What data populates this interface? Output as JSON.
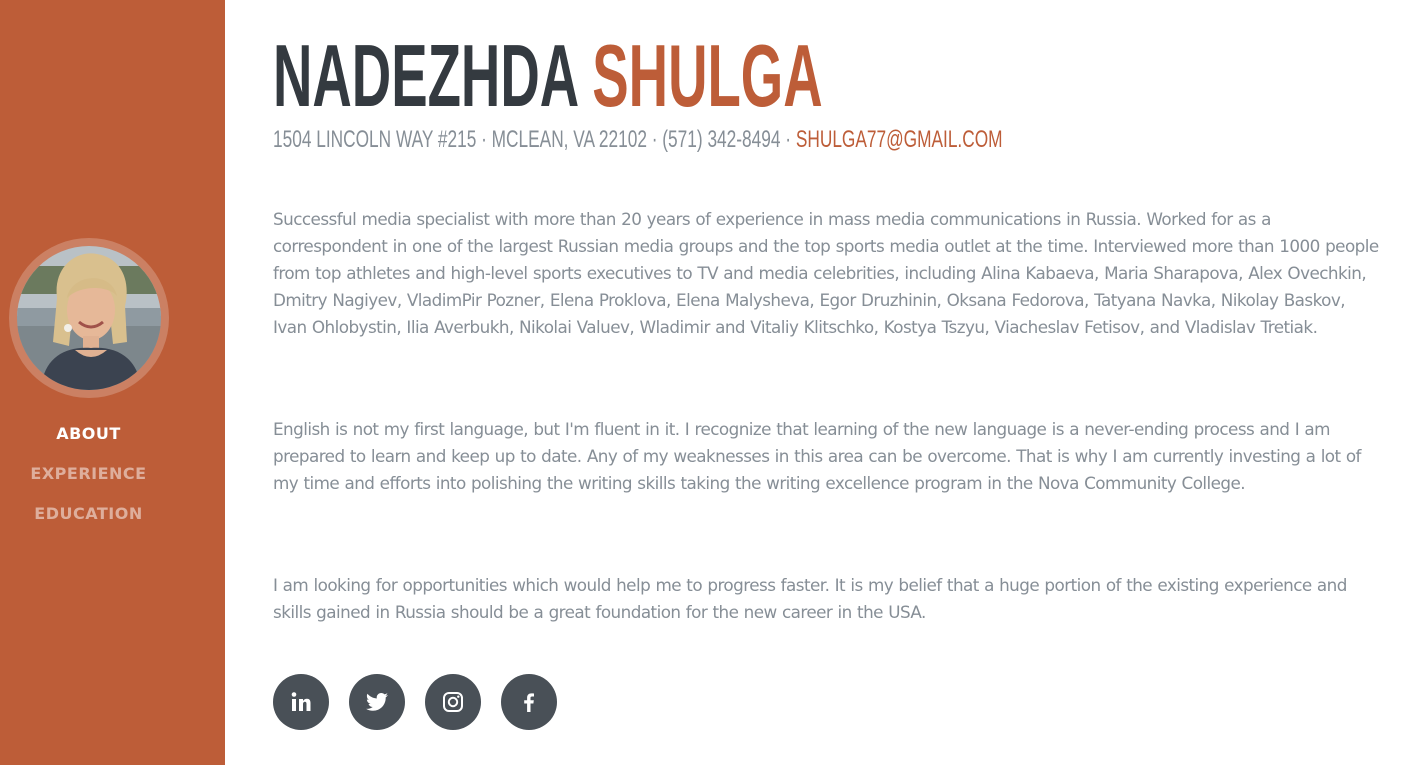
{
  "profile": {
    "first_name": "NADEZHDA",
    "last_name": "SHULGA",
    "address": "1504 LINCOLN WAY #215 · MCLEAN, VA 22102 · (571) 342-8494 ·",
    "email": "SHULGA77@GMAIL.COM"
  },
  "nav": {
    "items": [
      {
        "label": "ABOUT",
        "active": true
      },
      {
        "label": "EXPERIENCE",
        "active": false
      },
      {
        "label": "EDUCATION",
        "active": false
      }
    ]
  },
  "about": {
    "paragraphs": [
      "Successful media specialist with more than 20 years of experience in mass media communications in Russia. Worked for as a correspondent in one of the largest Russian media groups and the top sports media outlet at the time. Interviewed more than 1000 people from top athletes and high-level sports executives to TV and media celebrities, including Alina Kabaeva, Maria Sharapova, Alex Ovechkin, Dmitry Nagiyev, VladimPir Pozner, Elena Proklova, Elena Malysheva, Egor Druzhinin, Oksana Fedorova, Tatyana Navka, Nikolay Baskov, Ivan Ohlobystin, Ilia Averbukh, Nikolai Valuev, Wladimir and Vitaliy Klitschko, Kostya Tszyu, Viacheslav Fetisov, and Vladislav Tretiak.",
      "English is not my first language, but I'm fluent in it. I recognize that learning of the new language is a never-ending process and I am prepared to learn and keep up to date. Any of my weaknesses in this area can be overcome. That is why I am currently investing a lot of my time and efforts into polishing the writing skills taking the writing excellence program in the Nova Community College.",
      "I am looking for opportunities which would help me to progress faster. It is my belief that a huge portion of the existing experience and skills gained in Russia should be a great foundation for the new career in the USA."
    ]
  },
  "social": [
    {
      "icon": "linkedin-icon"
    },
    {
      "icon": "twitter-icon"
    },
    {
      "icon": "instagram-icon"
    },
    {
      "icon": "facebook-icon"
    }
  ],
  "colors": {
    "primary": "#bd5d38",
    "heading": "#343a40",
    "muted": "#868e96",
    "social_bg": "#495057"
  }
}
